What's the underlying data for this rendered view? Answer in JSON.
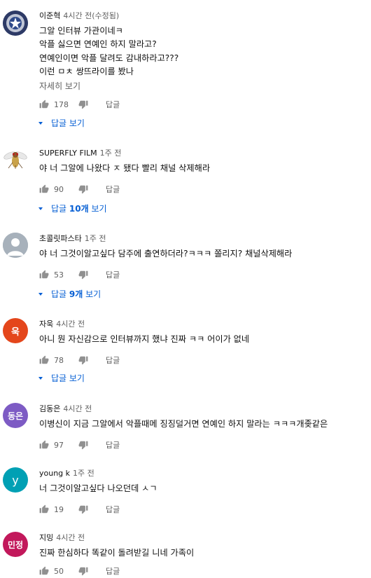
{
  "comments": [
    {
      "author": "이준혁",
      "time": "4시간 전(수정됨)",
      "avatar_color": "#3b4a78",
      "lines": [
        "그알 인터뷰 가관이네ㅋ",
        "악플 싫으면 연예인 하지 말라고?",
        "연예인이면 악플 달려도 감내하라고???",
        "이런 ㅁㅊ 쌍뜨라이를 봤나"
      ],
      "more_label": "자세히 보기",
      "likes": "178",
      "reply_label": "답글",
      "view_replies": {
        "pre": "답글 보기",
        "count": "",
        "post": ""
      }
    },
    {
      "author": "SUPERFLY FILM",
      "time": "1주 전",
      "avatar_color": "#ffffff",
      "lines": [
        "야 너 그알에 나왔다 ㅈ 됐다 빨리 채널 삭제해라"
      ],
      "likes": "90",
      "reply_label": "답글",
      "view_replies": {
        "pre": "답글 ",
        "count": "10개",
        "post": " 보기"
      }
    },
    {
      "author": "초콜릿파스타",
      "time": "1주 전",
      "avatar_color": "#9aa6b2",
      "lines": [
        "야 너 그것이알고싶다 담주에 출연하더라?ㅋㅋㅋ 쫄리지? 채널삭제해라"
      ],
      "likes": "53",
      "reply_label": "답글",
      "view_replies": {
        "pre": "답글 ",
        "count": "9개",
        "post": " 보기"
      }
    },
    {
      "author": "자욱",
      "time": "4시간 전",
      "avatar_text": "욱",
      "avatar_color": "#e4461b",
      "lines": [
        "아니 뭔 자신감으로 인터뷰까지 했냐 진짜 ㅋㅋ 어이가 없네"
      ],
      "likes": "78",
      "reply_label": "답글",
      "view_replies": {
        "pre": "답글 보기",
        "count": "",
        "post": ""
      }
    },
    {
      "author": "김동은",
      "time": "4시간 전",
      "avatar_text": "동은",
      "avatar_color": "#7d5bc4",
      "lines": [
        "이병신이 지금 그알에서 악플때메 징징덜거면 연예인 하지 말라는 ㅋㅋㅋ개좆같은"
      ],
      "likes": "97",
      "reply_label": "답글"
    },
    {
      "author": "young k",
      "time": "1주 전",
      "avatar_text": "y",
      "avatar_color": "#00a0b4",
      "lines": [
        "너 그것이알고싶다 나오던데 ㅅㄱ"
      ],
      "likes": "19",
      "reply_label": "답글"
    },
    {
      "author": "지밍",
      "time": "4시간 전",
      "avatar_text": "민정",
      "avatar_color": "#c2185b",
      "lines": [
        "진짜 한심하다 똑같이 돌려받길 니네 가족이"
      ],
      "likes": "50",
      "reply_label": "답글"
    }
  ]
}
